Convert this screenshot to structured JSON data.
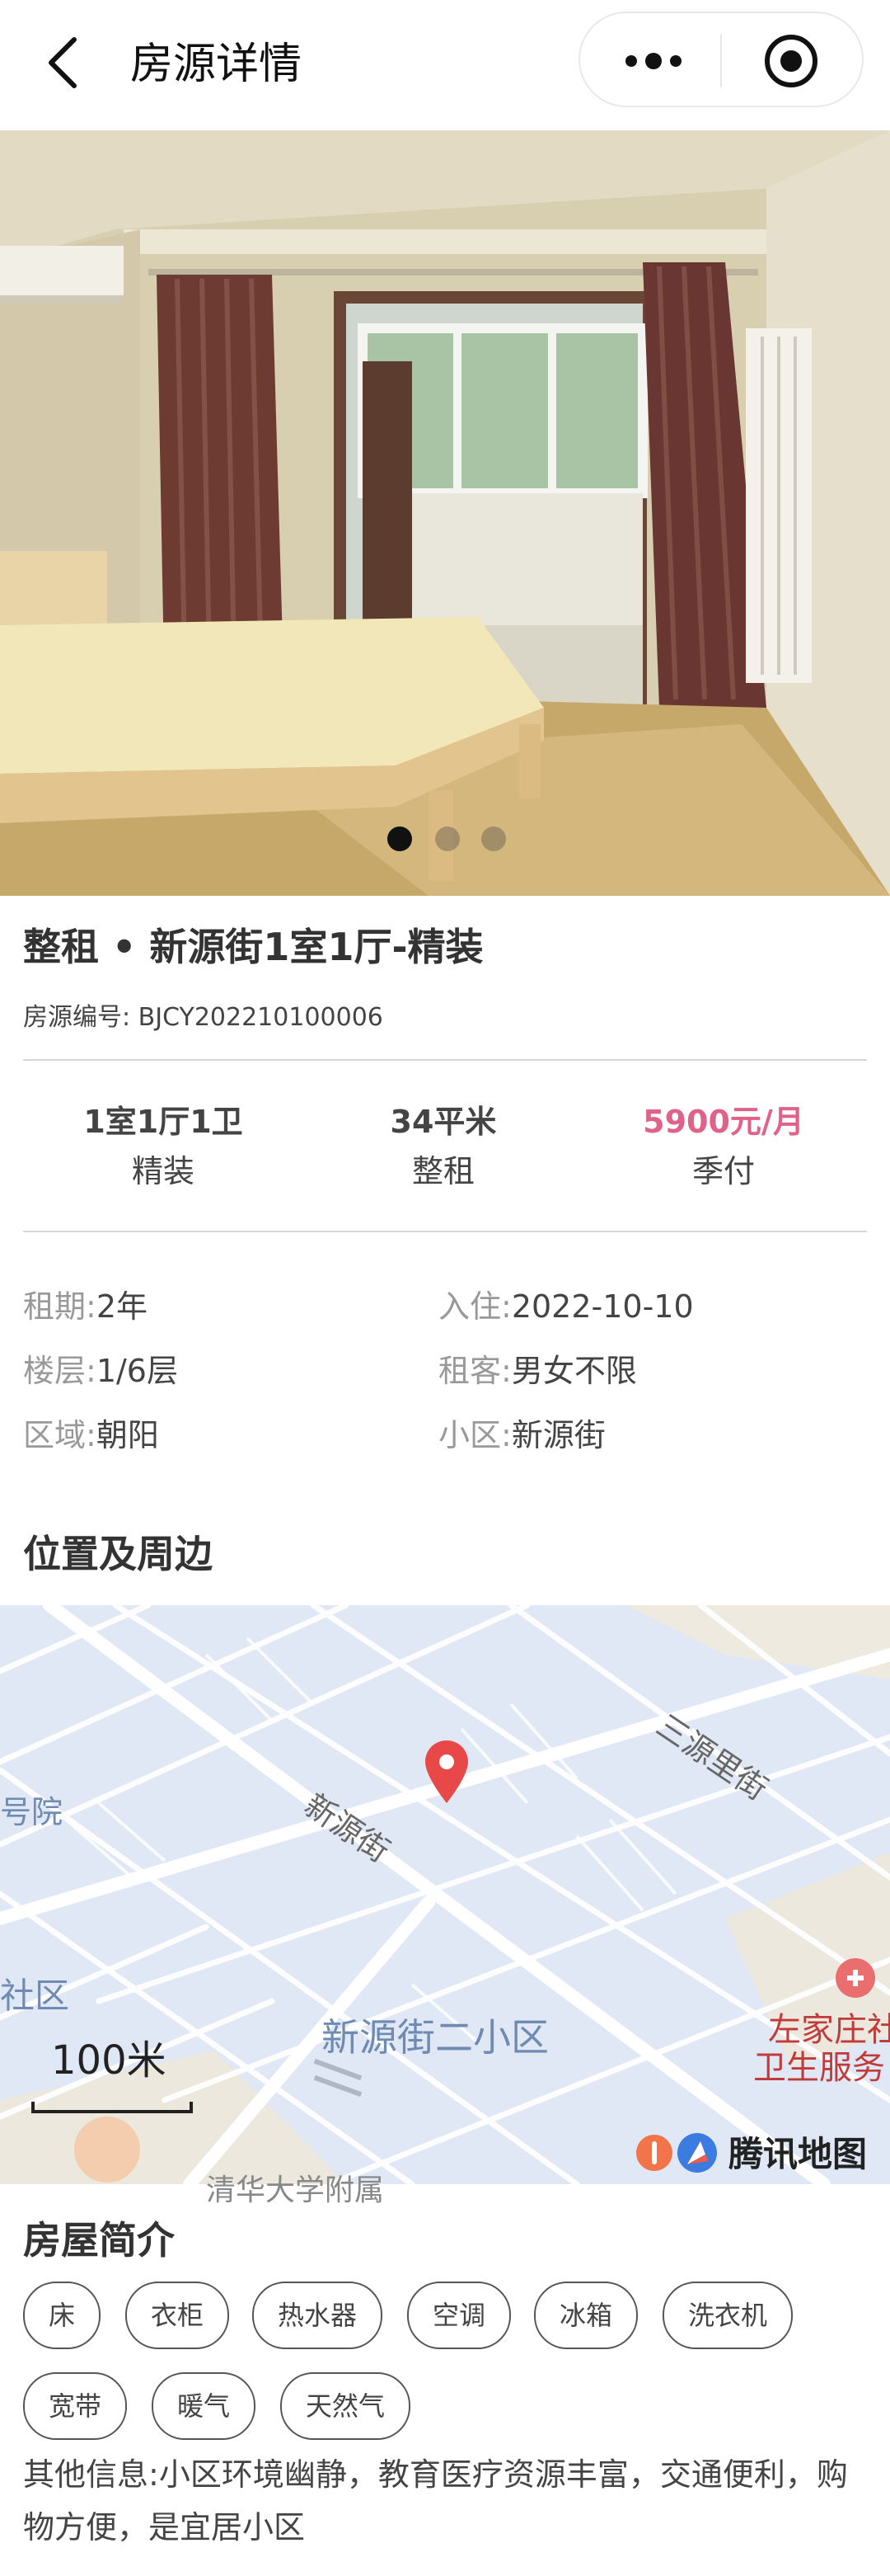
{
  "header": {
    "title": "房源详情",
    "back_icon": "chevron-left-icon",
    "more_icon": "more-dots-icon",
    "close_icon": "target-icon"
  },
  "gallery": {
    "photo_description_icon": "room-photo",
    "slide_count": 3,
    "active_index": 0
  },
  "listing": {
    "title": "整租 • 新源街1室1厅-精装",
    "id_label": "房源编号:",
    "id_value": "BJCY202210100006"
  },
  "summary": [
    {
      "top": "1室1厅1卫",
      "bottom": "精装"
    },
    {
      "top": "34平米",
      "bottom": "整租"
    },
    {
      "top": "5900元/月",
      "bottom": "季付"
    }
  ],
  "attributes": {
    "left": [
      {
        "key": "租期:",
        "value": "2年"
      },
      {
        "key": "楼层:",
        "value": "1/6层"
      },
      {
        "key": "区域:",
        "value": "朝阳"
      }
    ],
    "right": [
      {
        "key": "入住:",
        "value": "2022-10-10"
      },
      {
        "key": "租客:",
        "value": "男女不限"
      },
      {
        "key": "小区:",
        "value": "新源街"
      }
    ]
  },
  "location": {
    "section_title": "位置及周边",
    "map_labels": [
      "三源里街",
      "新源街",
      "号院",
      "社区",
      "新源街二小区",
      "左家庄社",
      "卫生服务",
      "清华大学附属"
    ],
    "scale": "100米",
    "brand": "腾讯地图"
  },
  "intro": {
    "section_title": "房屋简介",
    "tags": [
      "床",
      "衣柜",
      "热水器",
      "空调",
      "冰箱",
      "洗衣机",
      "宽带",
      "暖气",
      "天然气"
    ],
    "other_label": "其他信息:",
    "other_text": "小区环境幽静，教育医疗资源丰富，交通便利，购物方便，是宜居小区"
  },
  "colors": {
    "price": "#e06289",
    "map_bg": "#dfe8f4",
    "pin": "#e84848"
  }
}
